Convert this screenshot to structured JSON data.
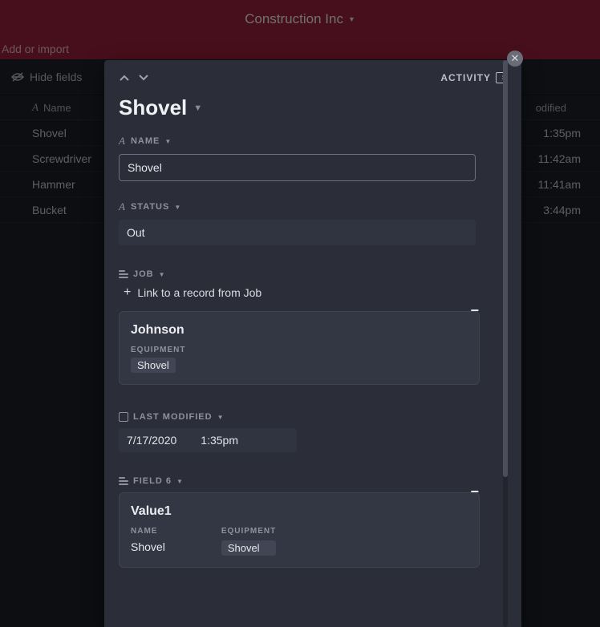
{
  "header": {
    "title": "Construction Inc"
  },
  "subheader": {
    "add_or_import": "Add or import"
  },
  "toolbar": {
    "hide_fields": "Hide fields"
  },
  "table": {
    "headers": {
      "name": "Name",
      "last_modified": "odified"
    },
    "rows": [
      {
        "name": "Shovel",
        "time": "1:35pm"
      },
      {
        "name": "Screwdriver",
        "time": "11:42am"
      },
      {
        "name": "Hammer",
        "time": "11:41am"
      },
      {
        "name": "Bucket",
        "time": "3:44pm"
      }
    ]
  },
  "panel": {
    "activity_label": "ACTIVITY",
    "title": "Shovel",
    "fields": {
      "name": {
        "label": "NAME",
        "value": "Shovel"
      },
      "status": {
        "label": "STATUS",
        "value": "Out"
      },
      "job": {
        "label": "JOB",
        "link_text": "Link to a record from Job",
        "card": {
          "title": "Johnson",
          "equipment_label": "EQUIPMENT",
          "equipment_value": "Shovel"
        }
      },
      "last_modified": {
        "label": "LAST MODIFIED",
        "date": "7/17/2020",
        "time": "1:35pm"
      },
      "field6": {
        "label": "FIELD 6",
        "card": {
          "title": "Value1",
          "name_label": "NAME",
          "name_value": "Shovel",
          "equipment_label": "EQUIPMENT",
          "equipment_value": "Shovel"
        }
      }
    }
  }
}
